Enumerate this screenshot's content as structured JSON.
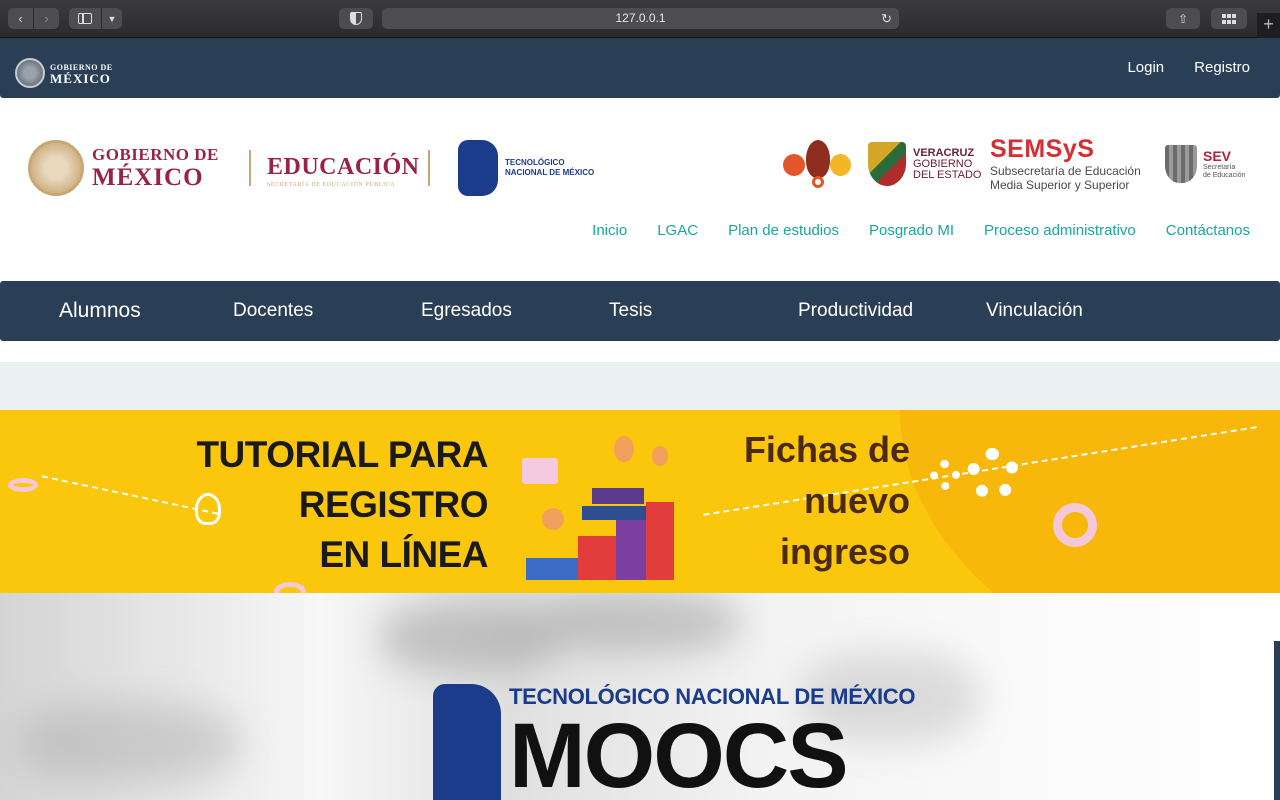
{
  "browser": {
    "url": "127.0.0.1",
    "icons": [
      "back-icon",
      "forward-icon",
      "sidebar-icon",
      "shield-icon",
      "reload-icon",
      "share-icon",
      "tabs-icon",
      "new-tab-icon"
    ]
  },
  "gob_header": {
    "logo_line1": "GOBIERNO DE",
    "logo_line2": "MÉXICO",
    "login": "Login",
    "registro": "Registro",
    "bg_color": "#2a3f55"
  },
  "logos": {
    "gob_line1": "GOBIERNO DE",
    "gob_line2": "MÉXICO",
    "educacion": "EDUCACIÓN",
    "educacion_sub": "SECRETARÍA DE EDUCACIÓN PÚBLICA",
    "tecnm_line1": "TECNOLÓGICO",
    "tecnm_line2": "NACIONAL DE MÉXICO",
    "veracruz_line1": "VERACRUZ",
    "veracruz_line2": "GOBIERNO",
    "veracruz_line3": "DEL ESTADO",
    "semsys": "SEMSyS",
    "semsys_line1": "Subsecretaría de Educación",
    "semsys_line2": "Media Superior y Superior",
    "sev": "SEV",
    "sev_line1": "Secretaría",
    "sev_line2": "de Educación"
  },
  "subnav": [
    "Inicio",
    "LGAC",
    "Plan de estudios",
    "Posgrado MI",
    "Proceso administrativo",
    "Contáctanos"
  ],
  "mainnav": [
    "Alumnos",
    "Docentes",
    "Egresados",
    "Tesis",
    "Productividad",
    "Vinculación"
  ],
  "banner": {
    "tutorial_line1": "TUTORIAL PARA",
    "tutorial_line2": "REGISTRO",
    "tutorial_line3": "EN LÍNEA",
    "fichas_line1": "Fichas de",
    "fichas_line2": "nuevo",
    "fichas_line3": "ingreso",
    "bg_color": "#fbc70d"
  },
  "hero": {
    "title": "TECNOLÓGICO NACIONAL DE MÉXICO",
    "big": "MOOCS"
  },
  "colors": {
    "accent_teal": "#17a89a",
    "brand_maroon": "#9b2247",
    "tecnm_blue": "#1b3b8b"
  }
}
